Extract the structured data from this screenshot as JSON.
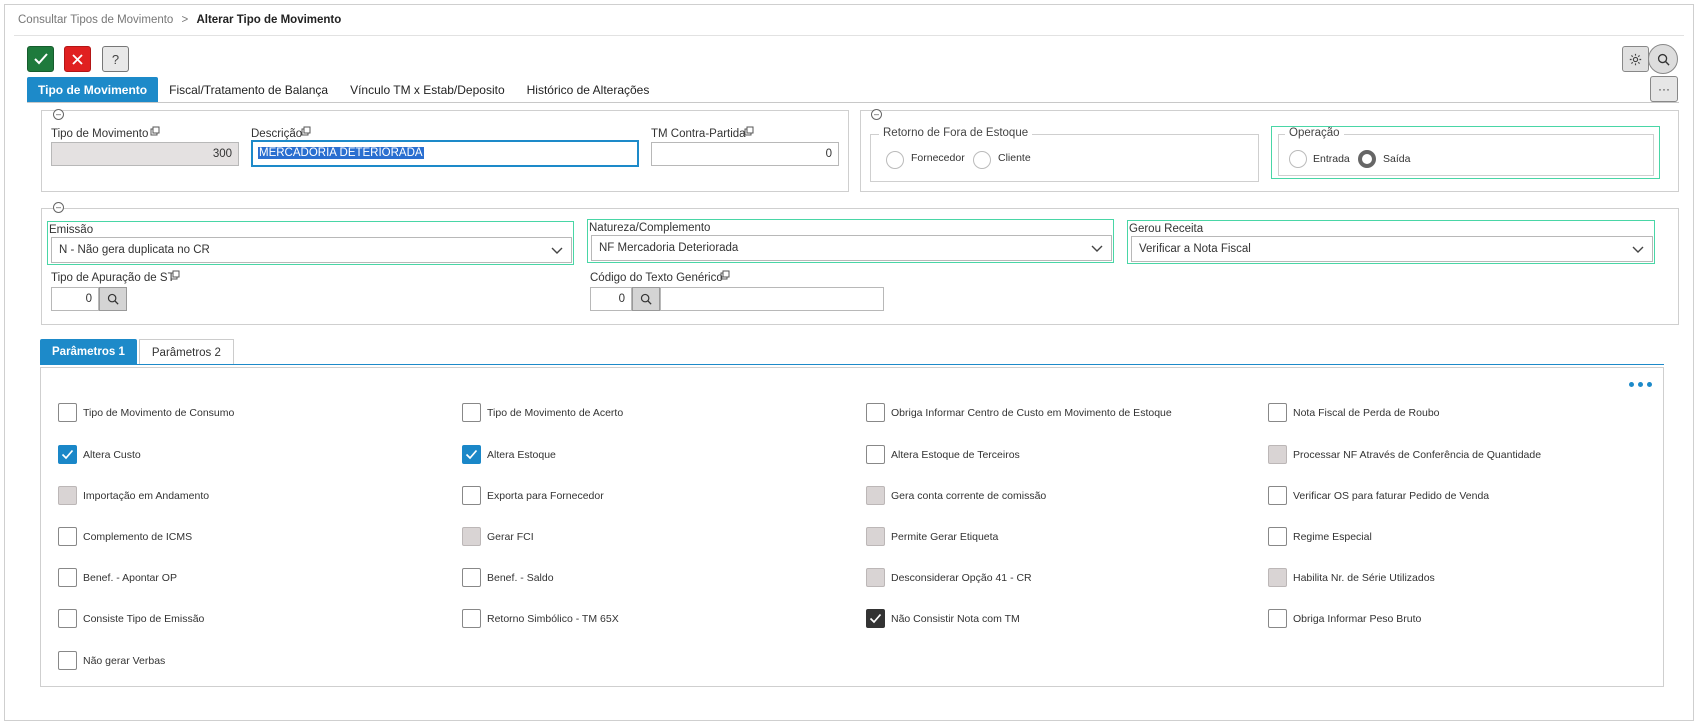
{
  "breadcrumb": {
    "parent": "Consultar Tipos de Movimento",
    "separator": ">",
    "current": "Alterar Tipo de Movimento"
  },
  "toolbar": {
    "help_label": "?",
    "more_label": "···"
  },
  "tabs": [
    "Tipo de Movimento",
    "Fiscal/Tratamento de Balança",
    "Vínculo TM x Estab/Deposito",
    "Histórico de Alterações"
  ],
  "section1": {
    "tipo_label": "Tipo de Movimento",
    "tipo_value": "300",
    "descricao_label": "Descrição",
    "descricao_value": "MERCADORIA DETERIORADA",
    "contra_label": "TM Contra-Partida",
    "contra_value": "0",
    "retorno_legend": "Retorno de Fora de Estoque",
    "retorno_options": [
      "Fornecedor",
      "Cliente"
    ],
    "operacao_legend": "Operação",
    "operacao_options": [
      "Entrada",
      "Saída"
    ],
    "operacao_selected": "Saída"
  },
  "section2": {
    "emissao_label": "Emissão",
    "emissao_value": "N - Não gera duplicata no CR",
    "natureza_label": "Natureza/Complemento",
    "natureza_value": "NF Mercadoria Deteriorada",
    "gerou_label": "Gerou Receita",
    "gerou_value": "Verificar a Nota Fiscal",
    "apuracao_label": "Tipo de Apuração de ST",
    "apuracao_value": "0",
    "codigo_label": "Código do Texto Genérico",
    "codigo_value": "0"
  },
  "param_tabs": [
    "Parâmetros 1",
    "Parâmetros 2"
  ],
  "params": [
    {
      "label": "Tipo de Movimento de Consumo",
      "state": "unchecked"
    },
    {
      "label": "Tipo de Movimento de Acerto",
      "state": "unchecked"
    },
    {
      "label": "Obriga Informar Centro de Custo em Movimento de Estoque",
      "state": "unchecked"
    },
    {
      "label": "Nota Fiscal de Perda de Roubo",
      "state": "unchecked"
    },
    {
      "label": "Altera Custo",
      "state": "checked"
    },
    {
      "label": "Altera Estoque",
      "state": "checked"
    },
    {
      "label": "Altera Estoque de Terceiros",
      "state": "unchecked"
    },
    {
      "label": "Processar NF Através de Conferência de Quantidade",
      "state": "disabled"
    },
    {
      "label": "Importação em Andamento",
      "state": "disabled"
    },
    {
      "label": "Exporta para Fornecedor",
      "state": "unchecked"
    },
    {
      "label": "Gera conta corrente de comissão",
      "state": "disabled"
    },
    {
      "label": "Verificar OS para faturar Pedido de Venda",
      "state": "unchecked"
    },
    {
      "label": "Complemento de ICMS",
      "state": "unchecked"
    },
    {
      "label": "Gerar FCI",
      "state": "disabled"
    },
    {
      "label": "Permite Gerar Etiqueta",
      "state": "disabled"
    },
    {
      "label": "Regime Especial",
      "state": "unchecked"
    },
    {
      "label": "Benef. - Apontar OP",
      "state": "unchecked"
    },
    {
      "label": "Benef. - Saldo",
      "state": "unchecked"
    },
    {
      "label": "Desconsiderar Opção 41 - CR",
      "state": "disabled"
    },
    {
      "label": "Habilita Nr. de Série Utilizados",
      "state": "disabled"
    },
    {
      "label": "Consiste Tipo de Emissão",
      "state": "unchecked"
    },
    {
      "label": "Retorno Simbólico - TM 65X",
      "state": "unchecked"
    },
    {
      "label": "Não Consistir Nota com TM",
      "state": "checked-dark"
    },
    {
      "label": "Obriga Informar Peso Bruto",
      "state": "unchecked"
    },
    {
      "label": "Não gerar Verbas",
      "state": "unchecked"
    }
  ],
  "colors": {
    "primary": "#1d8ac9",
    "ok": "#1e7a3c",
    "cancel": "#e02020",
    "highlight": "#49d6a6"
  }
}
